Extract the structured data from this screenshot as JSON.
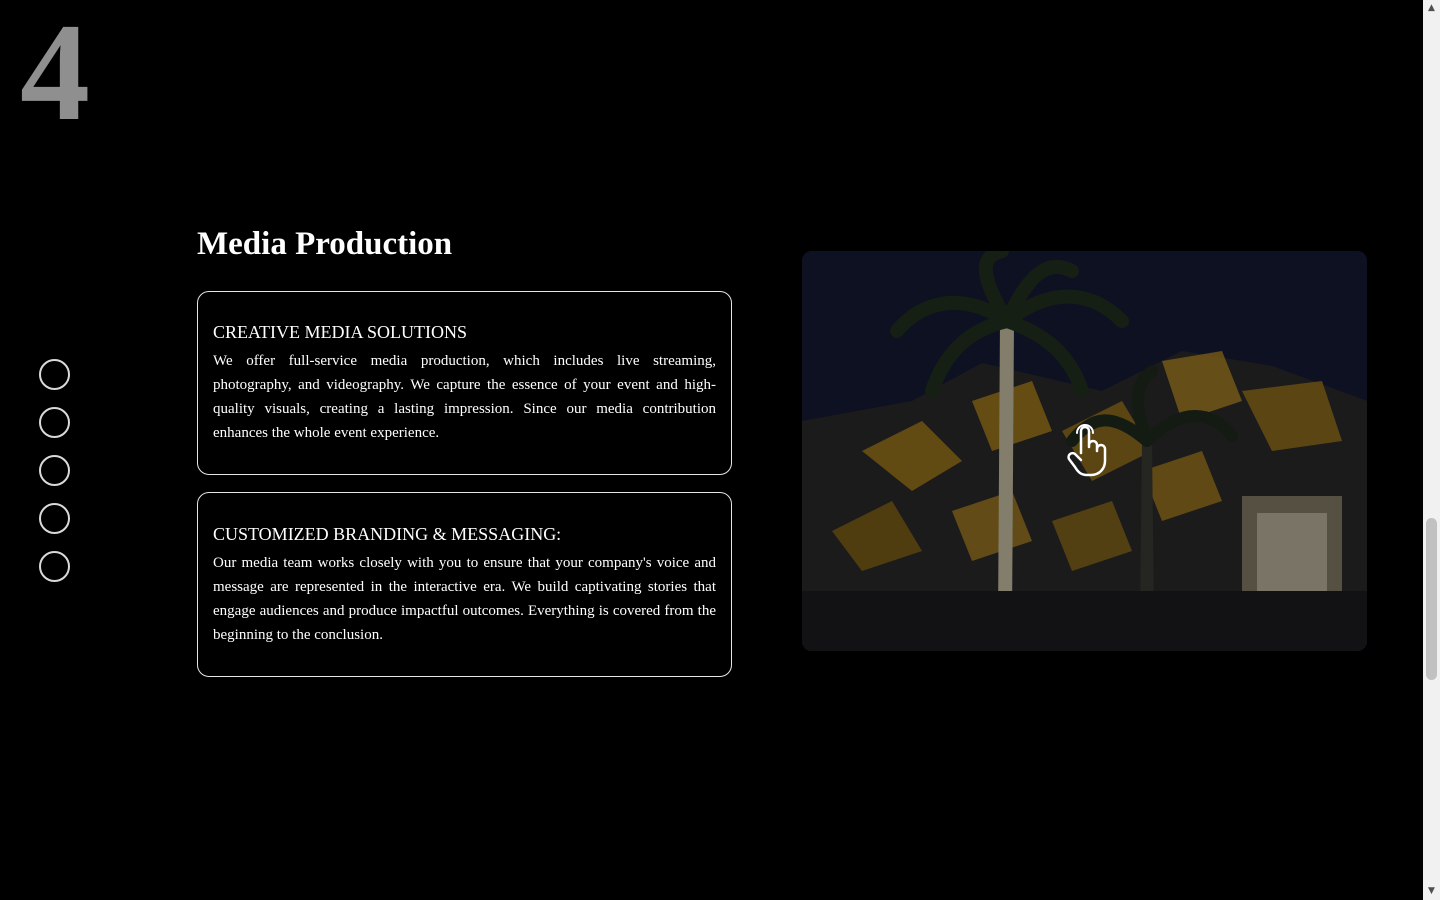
{
  "section": {
    "number": "4",
    "title": "Media Production"
  },
  "dot_nav": {
    "count": 5
  },
  "cards": [
    {
      "heading": "CREATIVE MEDIA SOLUTIONS",
      "text": "We offer full-service media production, which includes live streaming, photography, and videography. We capture the essence of your event and high-quality visuals, creating a lasting impression. Since our media contribution enhances the whole event experience."
    },
    {
      "heading": "CUSTOMIZED BRANDING & MESSAGING:",
      "text": "Our media team works closely with you to ensure that your company's voice and message are represented in the interactive era. We build captivating stories that engage audiences and produce impactful outcomes. Everything is covered from the beginning to the conclusion."
    }
  ],
  "media": {
    "icon": "hand-pointer-icon"
  },
  "colors": {
    "background": "#000000",
    "accent_gold": "#b8891c",
    "number_gray": "#8f8f8f"
  },
  "scrollbar": {
    "up_arrow": "▲",
    "down_arrow": "▼"
  }
}
